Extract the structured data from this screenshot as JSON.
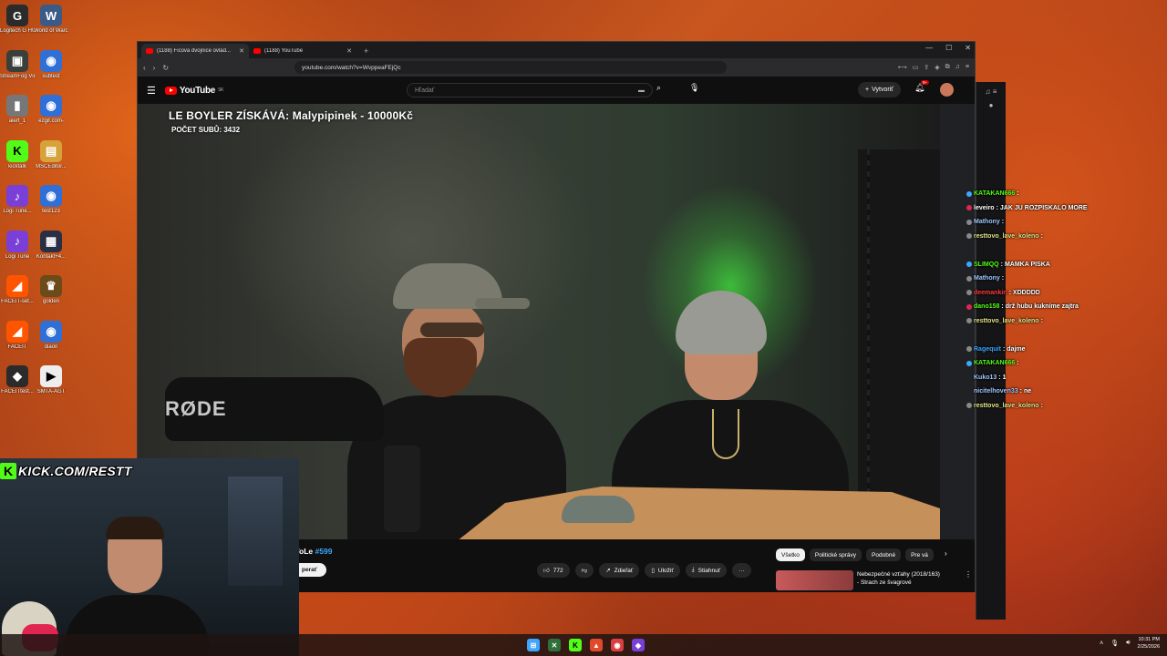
{
  "desktop": {
    "icons": [
      {
        "label": "Logitech G HUB",
        "glyph": "G",
        "color": "#2b2b2b"
      },
      {
        "label": "World of Warcraft",
        "glyph": "W",
        "color": "#3c5a86"
      },
      {
        "label": "StreamFog VirtualCam",
        "glyph": "▣",
        "color": "#3a3f3a"
      },
      {
        "label": "subtest",
        "glyph": "◉",
        "color": "#2f6fd6"
      },
      {
        "label": "alert_1",
        "glyph": "▮",
        "color": "#777"
      },
      {
        "label": "ezgif.com-",
        "glyph": "◉",
        "color": "#2f6fd6"
      },
      {
        "label": "kicktalk",
        "glyph": "K",
        "color": "#53fc18"
      },
      {
        "label": "MSCEditor...",
        "glyph": "▤",
        "color": "#d6a33a"
      },
      {
        "label": "Logi Tune...",
        "glyph": "♪",
        "color": "#7a3fd6"
      },
      {
        "label": "test123",
        "glyph": "◉",
        "color": "#2f6fd6"
      },
      {
        "label": "Logi Tune",
        "glyph": "♪",
        "color": "#7a3fd6"
      },
      {
        "label": "Kontakt+4...",
        "glyph": "▦",
        "color": "#2b2f45"
      },
      {
        "label": "FACEIT-set...",
        "glyph": "◢",
        "color": "#ff5500"
      },
      {
        "label": "golden",
        "glyph": "♛",
        "color": "#6b4b1a"
      },
      {
        "label": "FACEIT",
        "glyph": "◢",
        "color": "#ff5500"
      },
      {
        "label": "diaon",
        "glyph": "◉",
        "color": "#2f6fd6"
      },
      {
        "label": "FACEITtest...",
        "glyph": "◆",
        "color": "#2b2b2b"
      },
      {
        "label": "SMTA-AGT",
        "glyph": "▶",
        "color": "#eeeeee"
      }
    ]
  },
  "browser": {
    "tabs": [
      {
        "title": "(1188) Ficova dvojnice ovlád...",
        "active": true
      },
      {
        "title": "(1188) YouTube",
        "active": false
      }
    ],
    "new_tab": "+",
    "url": "youtube.com/watch?v=WvppeaFEjQc",
    "window_controls": [
      "—",
      "☐",
      "✕"
    ]
  },
  "youtube": {
    "logo_text": "YouTube",
    "logo_region": "SK",
    "search_placeholder": "Hľadať",
    "create_label": "Vytvoriť",
    "notif_badge": "9+",
    "video": {
      "overlay_title": "LE BOYLER ZÍSKÁVÁ: Malypipinek - 10000Kč",
      "overlay_subtitle": "POČET SUBŮ: 3432",
      "brand_text": "RØDE"
    },
    "below": {
      "title_prefix": "VoLe",
      "title_hash": "#599",
      "join_label": "perať",
      "likes": "772",
      "share_label": "Zdieľať",
      "save_label": "Uložiť",
      "download_label": "Stiahnuť",
      "more_label": "···"
    },
    "chips": [
      "Všetko",
      "Politické správy",
      "Podobné",
      "Pre vá"
    ],
    "recommendation": {
      "title_line1": "Nebezpečné vzťahy (2018/163)",
      "title_line2": "- Strach ze švagrové"
    }
  },
  "chat": {
    "lines": [
      {
        "user": "KATAKAN666",
        "msg": "",
        "color": "#53fc18",
        "badge": "#3ea6ff"
      },
      {
        "user": "leveiro",
        "msg": "JAK JU ROZPISKALO MORE",
        "color": "#ffffff",
        "badge": "#e02650"
      },
      {
        "user": "Mathony",
        "msg": "",
        "color": "#9ec7ff",
        "badge": "#888888"
      },
      {
        "user": "resttovo_lave_koleno",
        "msg": "",
        "color": "#e5e58a",
        "badge": "#888888"
      },
      {
        "user": "",
        "msg": "",
        "color": "#ffffff",
        "badge": "transparent"
      },
      {
        "user": "SLIMQQ",
        "msg": "MAMKA PISKA",
        "color": "#53fc18",
        "badge": "#3ea6ff"
      },
      {
        "user": "Mathony",
        "msg": "",
        "color": "#9ec7ff",
        "badge": "#888888"
      },
      {
        "user": "deemankin",
        "msg": "XDDDDD",
        "color": "#ff3b3b",
        "badge": "#888888"
      },
      {
        "user": "dano158",
        "msg": "drž hubu kukníme zajtra",
        "color": "#53fc18",
        "badge": "#e02650"
      },
      {
        "user": "resttovo_lave_koleno",
        "msg": "",
        "color": "#e5e58a",
        "badge": "#888888"
      },
      {
        "user": "",
        "msg": "",
        "color": "#ffffff",
        "badge": "transparent"
      },
      {
        "user": "Ragequit",
        "msg": "dajme",
        "color": "#3ea6ff",
        "badge": "#888888"
      },
      {
        "user": "KATAKAN666",
        "msg": "",
        "color": "#53fc18",
        "badge": "#3ea6ff"
      },
      {
        "user": "Kuko13",
        "msg": "1",
        "color": "#9ec7ff",
        "badge": "transparent"
      },
      {
        "user": "nicitelhoven33",
        "msg": "ne",
        "color": "#9ec7ff",
        "badge": "transparent"
      },
      {
        "user": "resttovo_lave_koleno",
        "msg": "",
        "color": "#e5e58a",
        "badge": "#888888"
      }
    ]
  },
  "overlay": {
    "kick_letter": "K",
    "kick_text": "KICK.COM/RESTT"
  },
  "taskbar": {
    "time": "10:31 PM",
    "date": "2/25/2026",
    "apps": [
      {
        "glyph": "⊞",
        "color": "#3ea6ff"
      },
      {
        "glyph": "✕",
        "color": "#2f6f3a"
      },
      {
        "glyph": "K",
        "color": "#53fc18"
      },
      {
        "glyph": "▲",
        "color": "#e04a2a"
      },
      {
        "glyph": "◉",
        "color": "#d94040"
      },
      {
        "glyph": "◆",
        "color": "#7a3fd6"
      }
    ]
  }
}
